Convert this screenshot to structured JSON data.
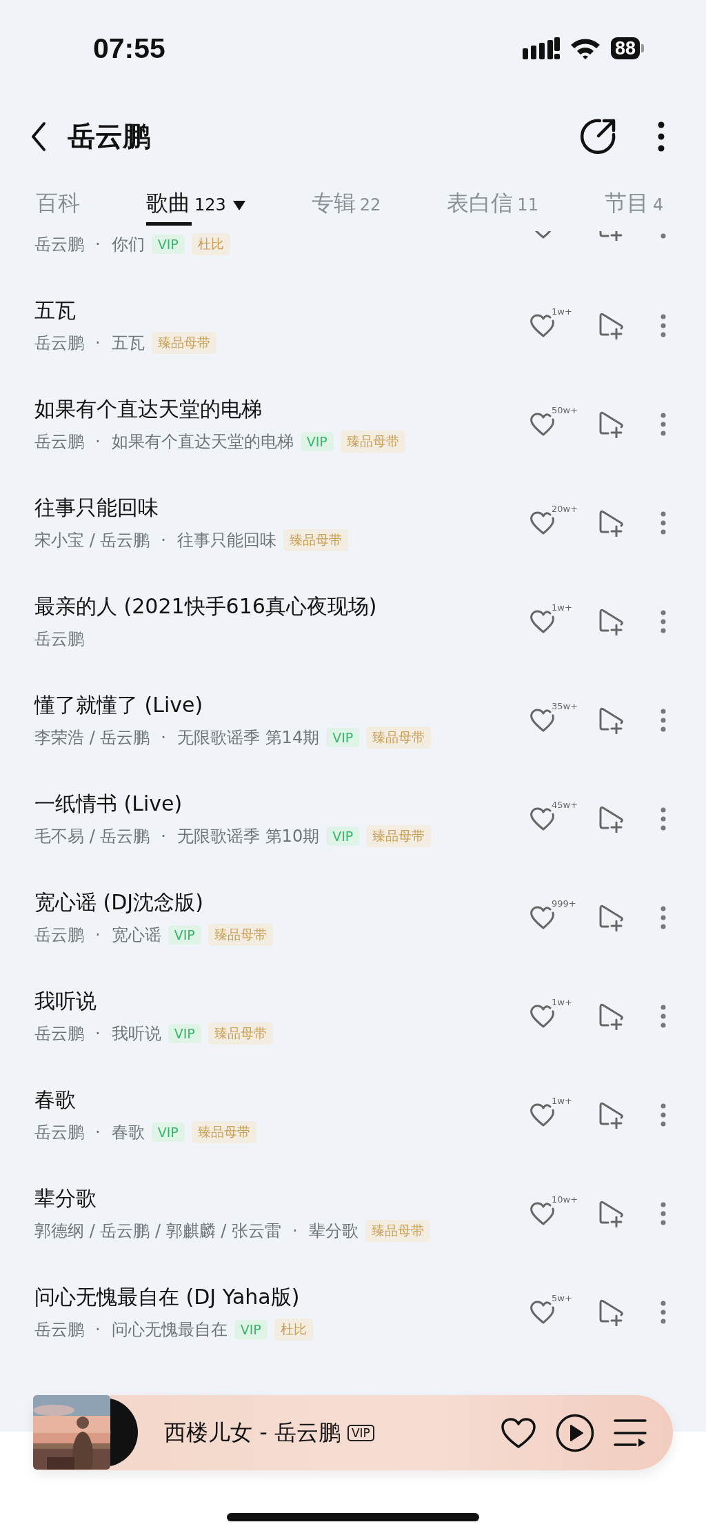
{
  "status_bar": {
    "time": "07:55",
    "battery": "88"
  },
  "header": {
    "title": "岳云鹏"
  },
  "tabs": [
    {
      "label": "百科",
      "selected": false
    },
    {
      "label": "歌曲",
      "count": "123",
      "selected": true,
      "dropdown": true
    },
    {
      "label": "专辑",
      "count": "22",
      "selected": false
    },
    {
      "label": "表白信",
      "count": "11",
      "selected": false
    },
    {
      "label": "节目",
      "count": "4",
      "selected": false
    }
  ],
  "songs": [
    {
      "artists": "岳云鹏",
      "separator": "·",
      "album": "你们",
      "tags": [
        {
          "text": "VIP",
          "kind": "vip"
        },
        {
          "text": "杜比",
          "kind": "gold"
        }
      ]
    },
    {
      "title": "五瓦",
      "artists": "岳云鹏",
      "separator": "·",
      "album": "五瓦",
      "tags": [
        {
          "text": "臻品母带",
          "kind": "gold"
        }
      ],
      "likes": "1w+"
    },
    {
      "title": "如果有个直达天堂的电梯",
      "artists": "岳云鹏",
      "separator": "·",
      "album": "如果有个直达天堂的电梯",
      "tags": [
        {
          "text": "VIP",
          "kind": "vip"
        },
        {
          "text": "臻品母带",
          "kind": "gold"
        }
      ],
      "likes": "50w+"
    },
    {
      "title": "往事只能回味",
      "artists": "宋小宝 / 岳云鹏",
      "separator": "·",
      "album": "往事只能回味",
      "tags": [
        {
          "text": "臻品母带",
          "kind": "gold"
        }
      ],
      "likes": "20w+"
    },
    {
      "title": "最亲的人 (2021快手616真心夜现场)",
      "artists": "岳云鹏",
      "likes": "1w+"
    },
    {
      "title": "懂了就懂了 (Live)",
      "artists": "李荣浩 / 岳云鹏",
      "separator": "·",
      "album": "无限歌谣季 第14期",
      "tags": [
        {
          "text": "VIP",
          "kind": "vip"
        },
        {
          "text": "臻品母带",
          "kind": "gold"
        }
      ],
      "likes": "35w+"
    },
    {
      "title": "一纸情书 (Live)",
      "artists": "毛不易 / 岳云鹏",
      "separator": "·",
      "album": "无限歌谣季 第10期",
      "tags": [
        {
          "text": "VIP",
          "kind": "vip"
        },
        {
          "text": "臻品母带",
          "kind": "gold"
        }
      ],
      "likes": "45w+"
    },
    {
      "title": "宽心谣 (DJ沈念版)",
      "artists": "岳云鹏",
      "separator": "·",
      "album": "宽心谣",
      "tags": [
        {
          "text": "VIP",
          "kind": "vip"
        },
        {
          "text": "臻品母带",
          "kind": "gold"
        }
      ],
      "likes": "999+"
    },
    {
      "title": "我听说",
      "artists": "岳云鹏",
      "separator": "·",
      "album": "我听说",
      "tags": [
        {
          "text": "VIP",
          "kind": "vip"
        },
        {
          "text": "臻品母带",
          "kind": "gold"
        }
      ],
      "likes": "1w+"
    },
    {
      "title": "春歌",
      "artists": "岳云鹏",
      "separator": "·",
      "album": "春歌",
      "tags": [
        {
          "text": "VIP",
          "kind": "vip"
        },
        {
          "text": "臻品母带",
          "kind": "gold"
        }
      ],
      "likes": "1w+"
    },
    {
      "title": "辈分歌",
      "artists": "郭德纲 / 岳云鹏 / 郭麒麟 / 张云雷",
      "separator": "·",
      "album": "辈分歌",
      "tags": [
        {
          "text": "臻品母带",
          "kind": "gold"
        }
      ],
      "likes": "10w+"
    },
    {
      "title": "问心无愧最自在 (DJ Yaha版)",
      "artists": "岳云鹏",
      "separator": "·",
      "album": "问心无愧最自在",
      "tags": [
        {
          "text": "VIP",
          "kind": "vip"
        },
        {
          "text": "杜比",
          "kind": "gold"
        }
      ],
      "likes": "5w+"
    }
  ],
  "player": {
    "title": "西楼儿女 - 岳云鹏",
    "badge": "VIP"
  }
}
